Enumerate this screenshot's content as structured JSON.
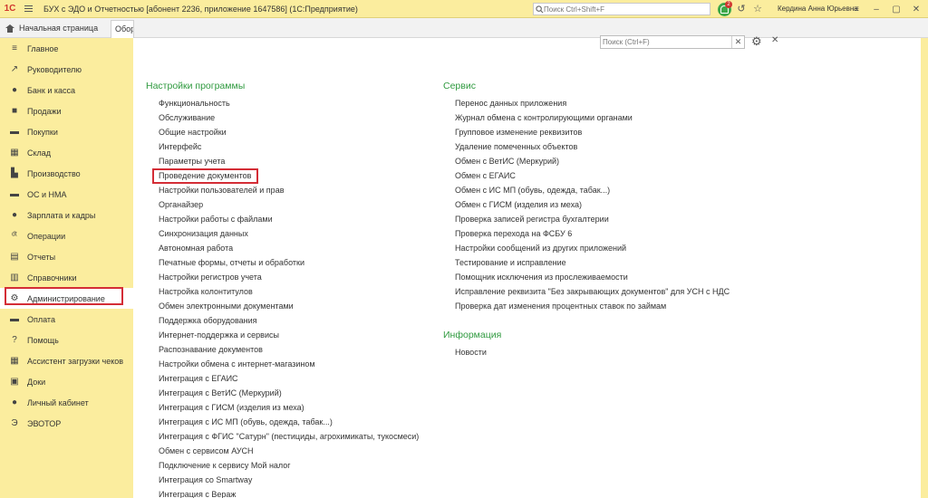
{
  "titlebar": {
    "logo": "1С",
    "title": "БУХ с ЭДО и Отчетностью [абонент 2236, приложение 1647586]  (1С:Предприятие)",
    "search_placeholder": "Поиск Ctrl+Shift+F",
    "notif_count": "2",
    "user": "Кердина Анна Юрьевна"
  },
  "tabs": {
    "home": "Начальная страница",
    "active": "Обор"
  },
  "sidebar": {
    "items": [
      {
        "label": "Главное",
        "icon": "≡"
      },
      {
        "label": "Руководителю",
        "icon": "↗"
      },
      {
        "label": "Банк и касса",
        "icon": "●"
      },
      {
        "label": "Продажи",
        "icon": "■"
      },
      {
        "label": "Покупки",
        "icon": "▬"
      },
      {
        "label": "Склад",
        "icon": "▦"
      },
      {
        "label": "Производство",
        "icon": "▙"
      },
      {
        "label": "ОС и НМА",
        "icon": "▬"
      },
      {
        "label": "Зарплата и кадры",
        "icon": "●"
      },
      {
        "label": "Операции",
        "icon": "ᵈᵗ"
      },
      {
        "label": "Отчеты",
        "icon": "▤"
      },
      {
        "label": "Справочники",
        "icon": "▥"
      },
      {
        "label": "Администрирование",
        "icon": "⚙"
      },
      {
        "label": "Оплата",
        "icon": "▬"
      },
      {
        "label": "Помощь",
        "icon": "?"
      },
      {
        "label": "Ассистент загрузки чеков",
        "icon": "▦"
      },
      {
        "label": "Доки",
        "icon": "▣"
      },
      {
        "label": "Личный кабинет",
        "icon": "●"
      },
      {
        "label": "ЭВОТОР",
        "icon": "Э"
      }
    ]
  },
  "form": {
    "search_placeholder": "Поиск (Ctrl+F)"
  },
  "left_section": {
    "title": "Настройки программы",
    "links": [
      "Функциональность",
      "Обслуживание",
      "Общие настройки",
      "Интерфейс",
      "Параметры учета",
      "Проведение документов",
      "Настройки пользователей и прав",
      "Органайзер",
      "Настройки работы с файлами",
      "Синхронизация данных",
      "Автономная работа",
      "Печатные формы, отчеты и обработки",
      "Настройки регистров учета",
      "Настройка колонтитулов",
      "Обмен электронными документами",
      "Поддержка оборудования",
      "Интернет-поддержка и сервисы",
      "Распознавание документов",
      "Настройки обмена с интернет-магазином",
      "Интеграция с ЕГАИС",
      "Интеграция с ВетИС (Меркурий)",
      "Интеграция с ГИСМ (изделия из меха)",
      "Интеграция с ИС МП (обувь, одежда, табак...)",
      "Интеграция с ФГИС \"Сатурн\" (пестициды, агрохимикаты, тукосмеси)",
      "Обмен с сервисом АУСН",
      "Подключение к сервису Мой налог",
      "Интеграция со Smartway",
      "Интеграция с Вераж"
    ]
  },
  "right_section": {
    "title": "Сервис",
    "links": [
      "Перенос данных приложения",
      "Журнал обмена с контролирующими органами",
      "Групповое изменение реквизитов",
      "Удаление помеченных объектов",
      "Обмен с ВетИС (Меркурий)",
      "Обмен с ЕГАИС",
      "Обмен с ИС МП (обувь, одежда, табак...)",
      "Обмен с ГИСМ (изделия из меха)",
      "Проверка записей регистра бухгалтерии",
      "Проверка перехода на ФСБУ 6",
      "Настройки сообщений из других приложений",
      "Тестирование и исправление",
      "Помощник исключения из прослеживаемости",
      "Исправление реквизита \"Без закрывающих документов\" для УСН с НДС",
      "Проверка дат изменения процентных ставок по займам"
    ]
  },
  "info_section": {
    "title": "Информация",
    "links": [
      "Новости"
    ]
  },
  "colors": {
    "sidebar_bg": "#fbed9e",
    "section_title": "#2f9a3f",
    "highlight": "#d42d36"
  }
}
